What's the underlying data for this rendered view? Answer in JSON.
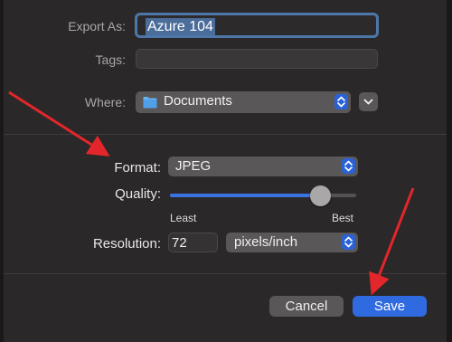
{
  "export": {
    "label": "Export As:",
    "filename": "Azure 104"
  },
  "tags": {
    "label": "Tags:",
    "value": ""
  },
  "where": {
    "label": "Where:",
    "value": "Documents"
  },
  "format": {
    "label": "Format:",
    "value": "JPEG"
  },
  "quality": {
    "label": "Quality:",
    "min_label": "Least",
    "max_label": "Best",
    "level_percent": 81
  },
  "resolution": {
    "label": "Resolution:",
    "value": "72",
    "unit": "pixels/inch"
  },
  "buttons": {
    "cancel": "Cancel",
    "save": "Save"
  },
  "colors": {
    "accent": "#2f6ae0",
    "annotation_arrow": "#e3262b"
  },
  "icons": [
    "folder-icon",
    "stepper-icon",
    "chevron-down-icon",
    "arrow-annotation"
  ]
}
